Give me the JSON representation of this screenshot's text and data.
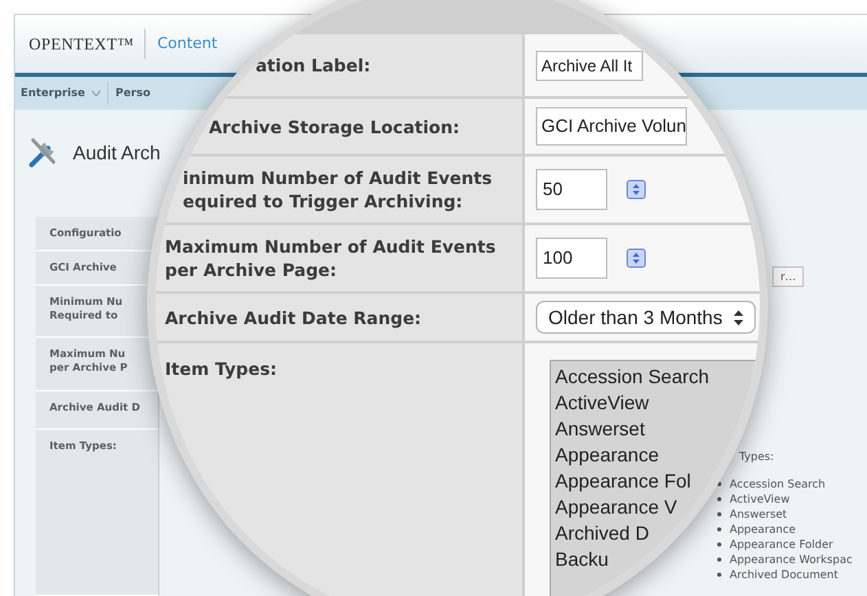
{
  "header": {
    "brand": "OPENTEXT™",
    "product": "Content"
  },
  "nav": [
    {
      "label": "Enterprise",
      "dropdown": true
    },
    {
      "label": "Perso",
      "dropdown": false
    }
  ],
  "page_title": "Audit Arch",
  "background_form": {
    "labels": [
      "Configuratio",
      "GCI Archive",
      "Minimum Nu\nRequired to",
      "Maximum Nu\nper Archive P",
      "Archive Audit D",
      "Item Types:"
    ],
    "button": "r…",
    "item_types_heading": "Types:",
    "item_types": [
      "Accession Search",
      "ActiveView",
      "Answerset",
      "Appearance",
      "Appearance Folder",
      "Appearance Workspac",
      "Archived Document"
    ]
  },
  "magnifier": {
    "rows": [
      {
        "label": "ation Label:",
        "kind": "text",
        "value": "Archive All It"
      },
      {
        "label": "Archive Storage Location:",
        "kind": "text",
        "value": "GCI Archive Volun"
      },
      {
        "label": "inimum Number of Audit Events\nequired to Trigger Archiving:",
        "kind": "number",
        "value": "50"
      },
      {
        "label": "Maximum Number of Audit Events\nper Archive Page:",
        "kind": "number",
        "value": "100"
      },
      {
        "label": "Archive Audit Date Range:",
        "kind": "select",
        "value": "Older than 3 Months"
      },
      {
        "label": "Item Types:",
        "kind": "list",
        "items": [
          "Accession Search",
          "ActiveView",
          "Answerset",
          "Appearance",
          "Appearance Fol",
          "Appearance V",
          "Archived D",
          "Backu"
        ]
      }
    ]
  }
}
